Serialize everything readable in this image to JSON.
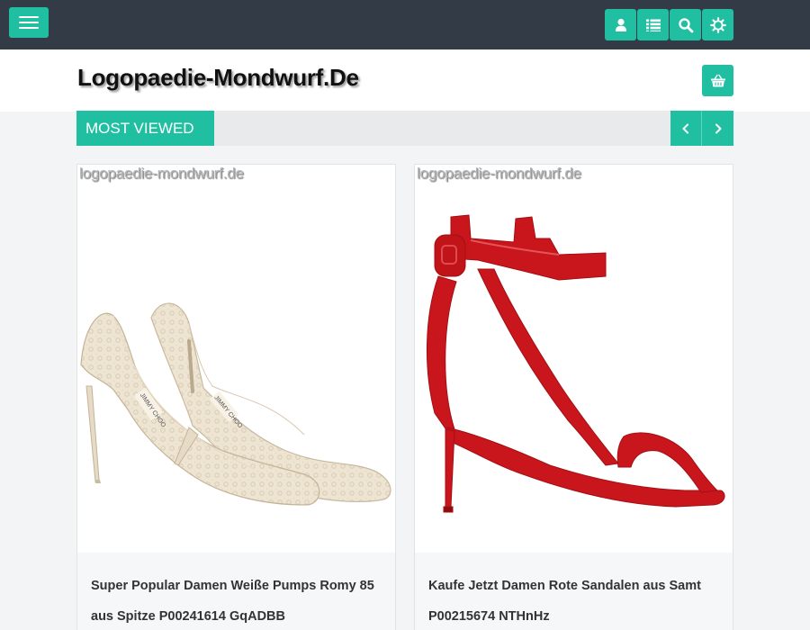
{
  "topbar": {
    "menu_icon": "hamburger-icon",
    "buttons": [
      {
        "name": "account",
        "icon": "user-icon"
      },
      {
        "name": "list",
        "icon": "list-icon"
      },
      {
        "name": "search",
        "icon": "search-icon"
      },
      {
        "name": "settings",
        "icon": "gear-icon"
      }
    ]
  },
  "header": {
    "logo": "Logopaedie-Mondwurf.De",
    "cart_icon": "basket-icon"
  },
  "section": {
    "title": "MOST VIEWED",
    "prev_icon": "chevron-left-icon",
    "next_icon": "chevron-right-icon"
  },
  "products": [
    {
      "watermark": "logopaedie-mondwurf.de",
      "title": "Super Popular Damen Weiße Pumps Romy 85 aus Spitze P00241614 GqADBB",
      "image": "cream-lace-pump-shoes"
    },
    {
      "watermark": "logopaedie-mondwurf.de",
      "title": "Kaufe Jetzt Damen Rote Sandalen aus Samt P00215674 NTHnHz",
      "image": "red-velvet-sandals"
    }
  ],
  "colors": {
    "accent": "#20bfa1",
    "topbar": "#333b47",
    "background": "#f3f4f5"
  }
}
